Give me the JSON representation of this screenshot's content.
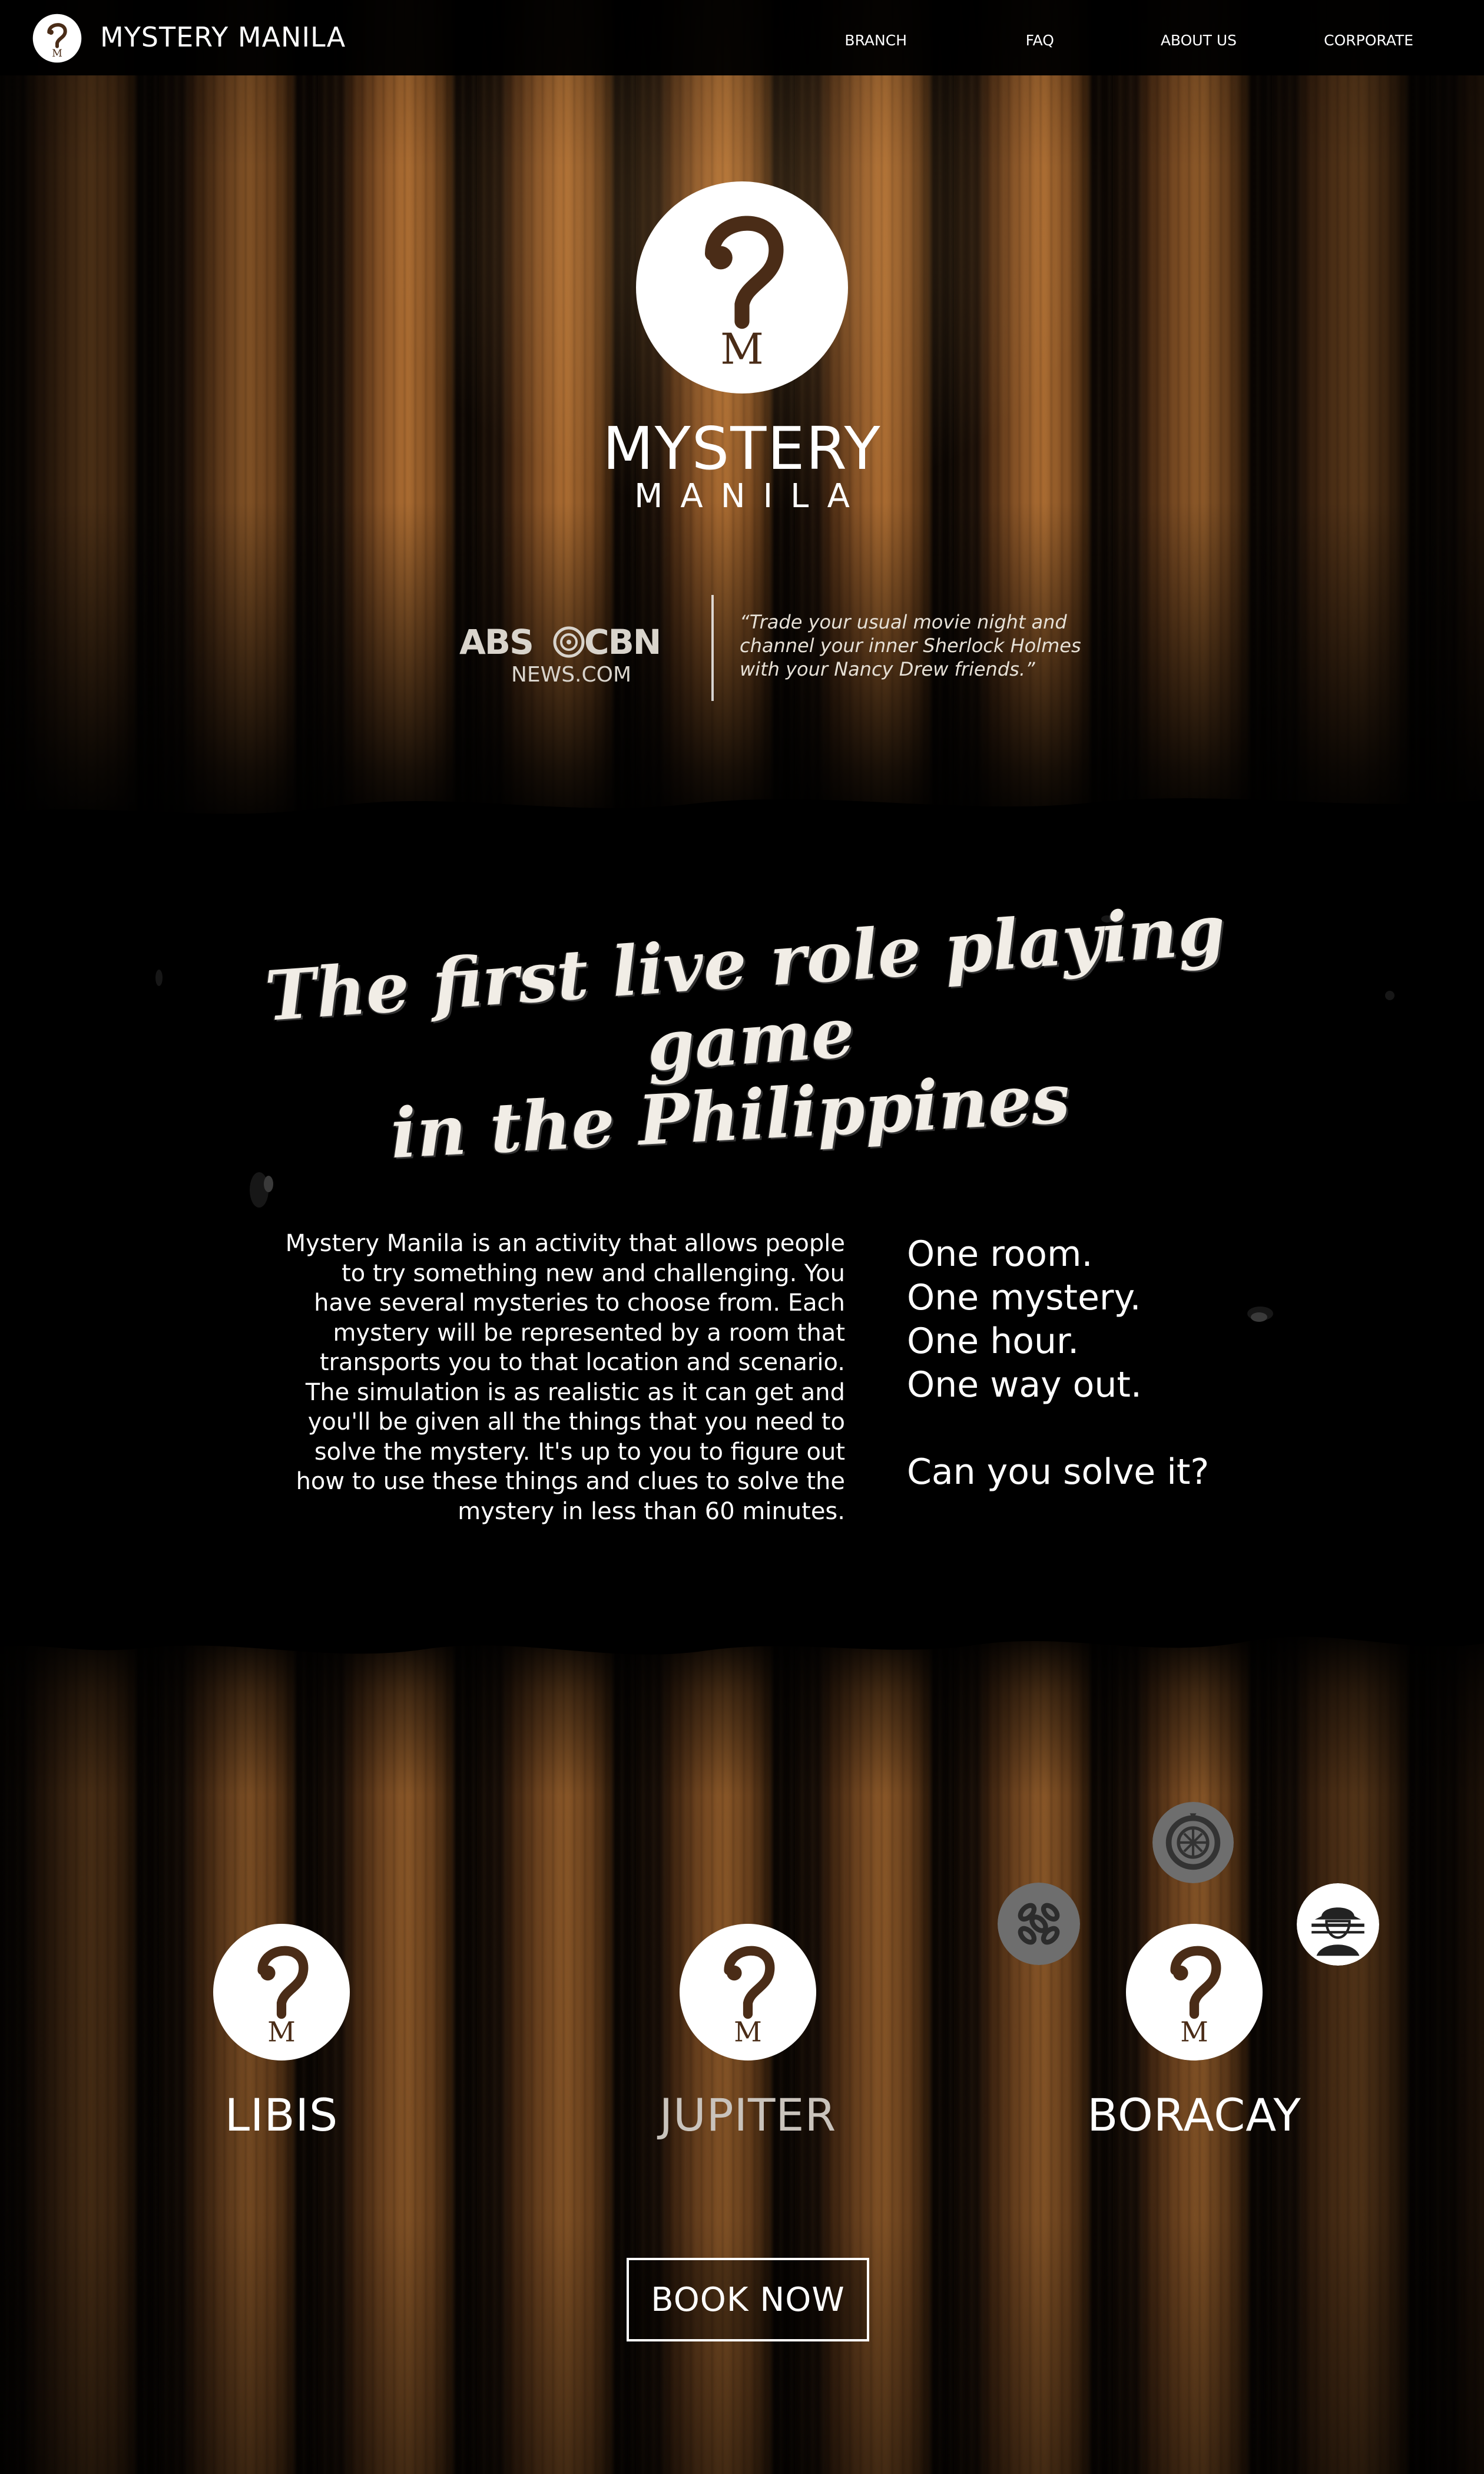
{
  "nav": {
    "brand": "MYSTERY MANILA",
    "links": [
      "BRANCH",
      "FAQ",
      "ABOUT US",
      "CORPORATE"
    ]
  },
  "hero": {
    "title": "MYSTERY",
    "subtitle": "MANILA"
  },
  "press": {
    "outlet_logo_text": "ABS-CBN",
    "outlet_sub": "NEWS.COM",
    "quote": "“Trade your usual movie night and channel your inner Sherlock Holmes with your Nancy Drew friends.”"
  },
  "tagline": {
    "line1": "The first live role playing game",
    "line2": "in the Philippines"
  },
  "about": {
    "text": "Mystery Manila is an activity that allows people to try something new and challenging. You have several mysteries to choose from. Each mystery will be represented by a room that transports you to that location and scenario. The simulation is as realistic as it can get and you'll be given all the things that you need to solve the mystery. It's up to you to figure out how to use these things and clues to solve the mystery in less than 60 minutes."
  },
  "slogan": {
    "lines": [
      "One room.",
      "One mystery.",
      "One hour.",
      "One way out."
    ],
    "question": "Can you solve it?"
  },
  "branches": [
    {
      "name": "LIBIS"
    },
    {
      "name": "JUPITER"
    },
    {
      "name": "BORACAY"
    }
  ],
  "cta": {
    "label": "BOOK NOW"
  },
  "colors": {
    "logo_brown": "#4a2c17",
    "wood_light": "#a96a30",
    "wood_dark": "#120a04",
    "background": "#000000"
  }
}
